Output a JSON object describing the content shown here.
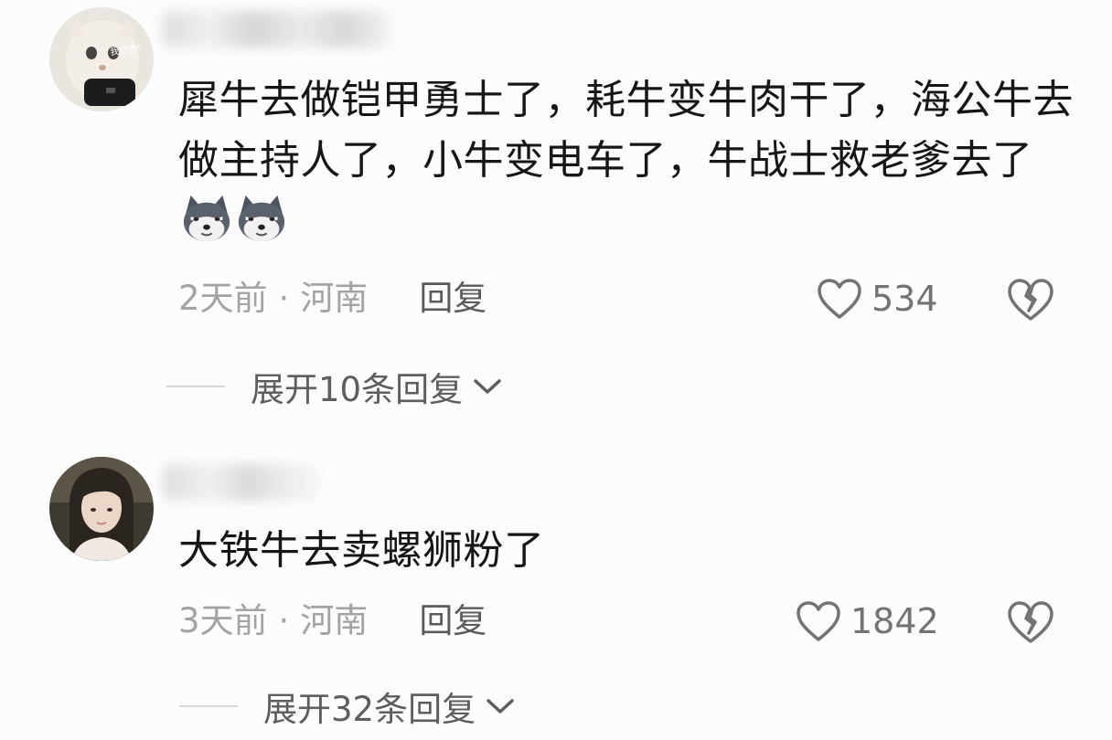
{
  "comments": [
    {
      "avatar_icon": "cat-avatar",
      "avatar_text": "我好你!",
      "text": "犀牛去做铠甲勇士了，耗牛变牛肉干了，海公牛去做主持人了，小牛变电车了，牛战士救老爹去了",
      "emojis": [
        "husky-emoji",
        "husky-emoji"
      ],
      "time": "2天前",
      "location": "河南",
      "reply_label": "回复",
      "likes": "534",
      "expand_label": "展开10条回复"
    },
    {
      "avatar_icon": "girl-avatar",
      "text": "大铁牛去卖螺狮粉了",
      "time": "3天前",
      "location": "河南",
      "reply_label": "回复",
      "likes": "1842",
      "expand_label": "展开32条回复"
    }
  ],
  "separator": "·",
  "colors": {
    "text": "#161616",
    "meta": "#a3a3a3",
    "icon": "#737373",
    "background": "#fcfcfc"
  }
}
